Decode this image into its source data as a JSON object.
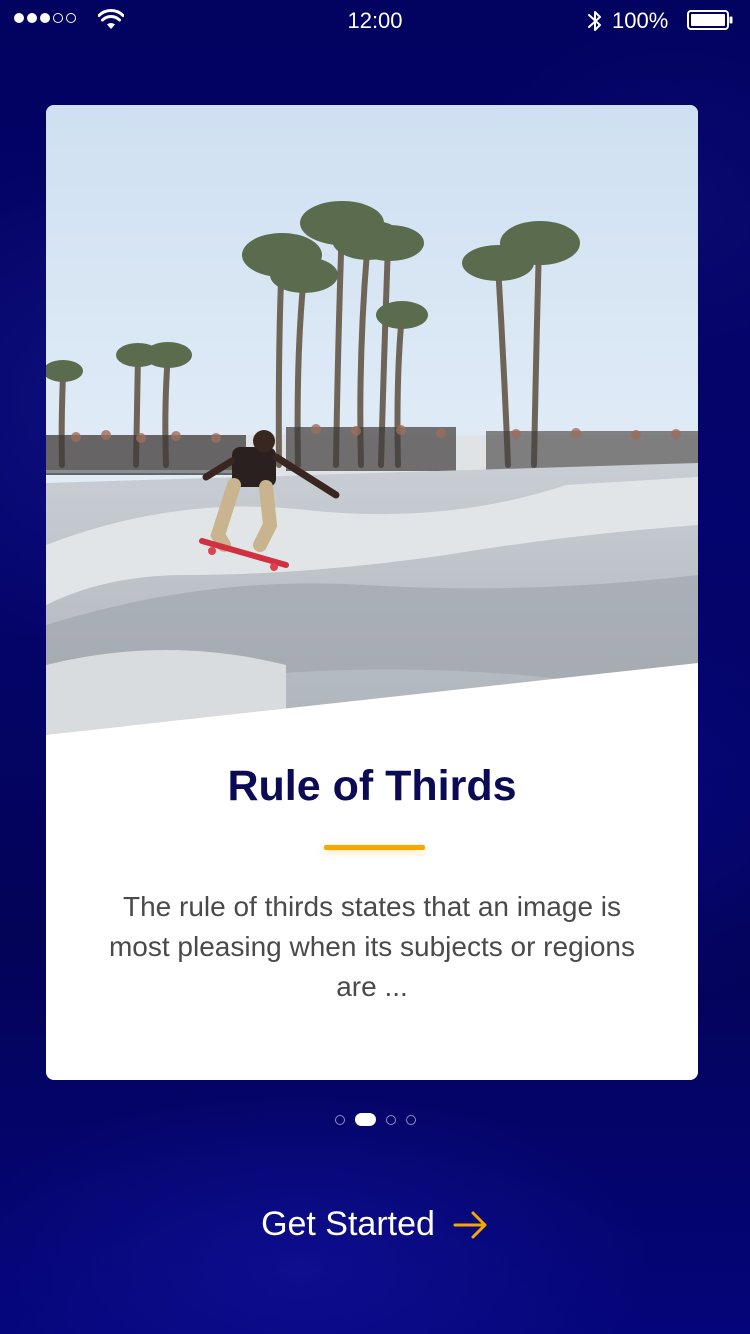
{
  "status_bar": {
    "time": "12:00",
    "battery_percent": "100%",
    "signal_bars_filled": 3,
    "signal_bars_total": 5,
    "icons": [
      "signal-dots-icon",
      "wifi-icon",
      "bluetooth-icon",
      "battery-icon"
    ]
  },
  "card": {
    "image_icon": "skatepark-photo",
    "title": "Rule of Thirds",
    "description": "The rule of thirds states that an image is most pleasing when its subjects or regions are ...",
    "accent_color": "#f5a800",
    "title_color": "#0a0a55"
  },
  "pager": {
    "total": 4,
    "active_index": 1
  },
  "cta": {
    "label": "Get Started",
    "icon": "arrow-right-icon",
    "arrow_color": "#f5a800"
  },
  "colors": {
    "background": "#04046e"
  }
}
